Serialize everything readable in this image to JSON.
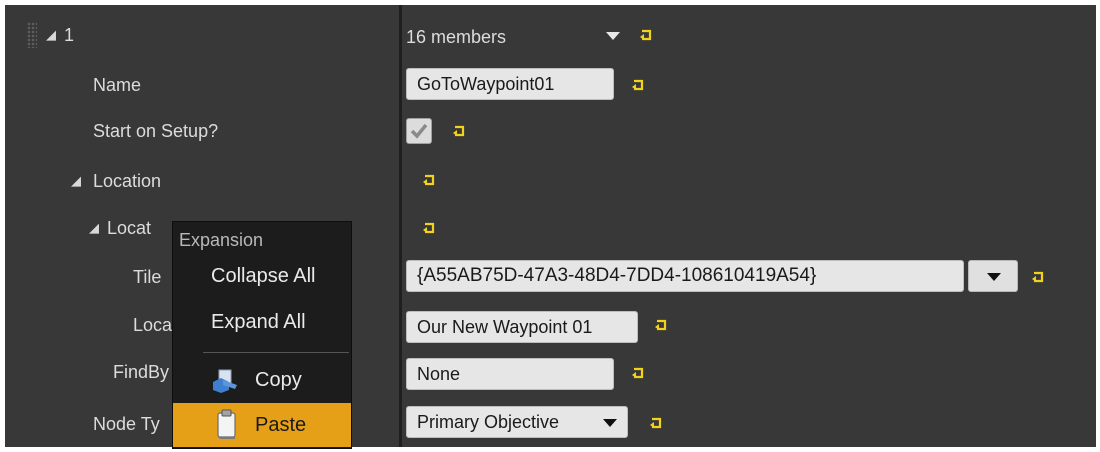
{
  "root_row": {
    "label": "1",
    "value": "16 members"
  },
  "properties": [
    {
      "name_key": "name",
      "label": "Name",
      "value": "GoToWaypoint01"
    },
    {
      "name_key": "start-on-setup",
      "label": "Start on Setup?",
      "checked": true
    },
    {
      "name_key": "location",
      "label": "Location"
    },
    {
      "name_key": "location-sub",
      "label": "Locat"
    },
    {
      "name_key": "tile",
      "label": "Tile",
      "value": "{A55AB75D-47A3-48D4-7DD4-108610419A54}"
    },
    {
      "name_key": "loca",
      "label": "Loca",
      "value": "Our New Waypoint 01"
    },
    {
      "name_key": "findby",
      "label": "FindBy",
      "value": "None"
    },
    {
      "name_key": "node-type",
      "label": "Node Ty",
      "value": "Primary Objective"
    }
  ],
  "context_menu": {
    "header": "Expansion",
    "items": [
      {
        "label": "Collapse All"
      },
      {
        "label": "Expand All"
      },
      {
        "label": "Copy",
        "icon": "copy-icon"
      },
      {
        "label": "Paste",
        "icon": "paste-icon",
        "highlighted": true
      }
    ]
  },
  "colors": {
    "panel": "#383838",
    "field": "#e6e6e6",
    "reset_arrow": "#f2d21a",
    "menu": "#1c1c1c",
    "menu_highlight": "#e5a018"
  }
}
